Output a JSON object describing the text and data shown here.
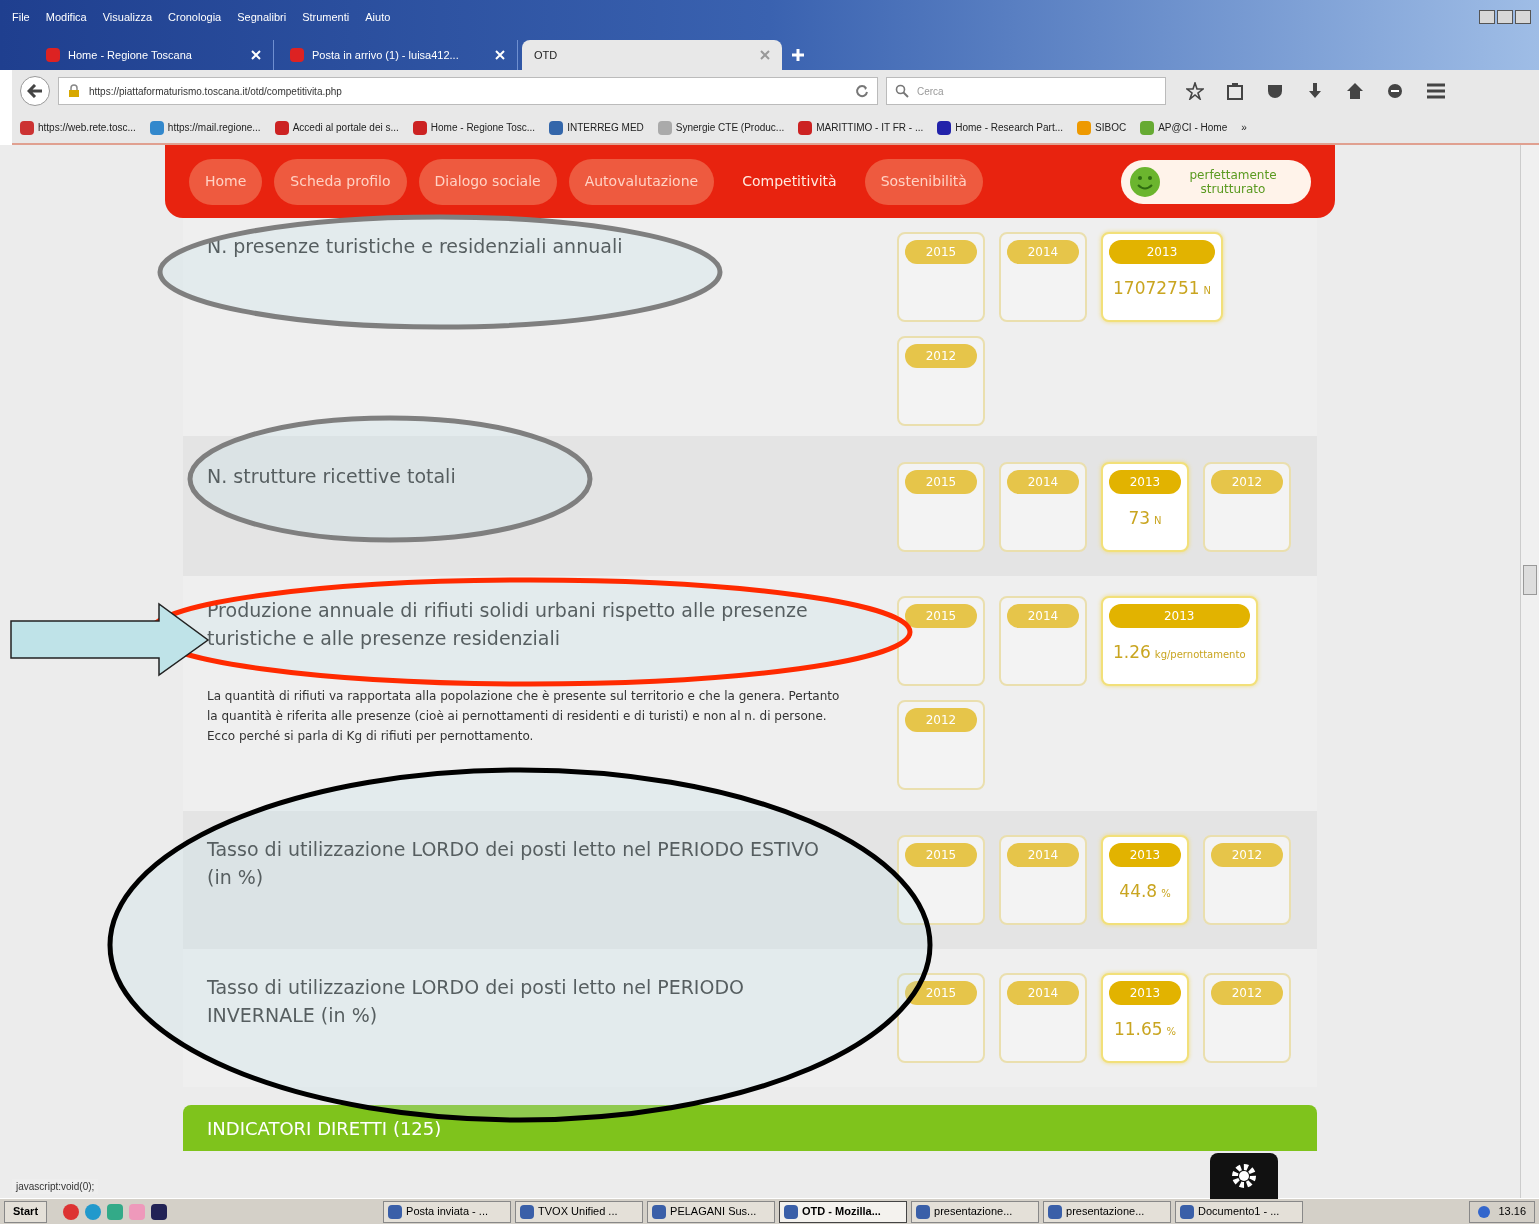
{
  "window": {
    "menu": [
      "File",
      "Modifica",
      "Visualizza",
      "Cronologia",
      "Segnalibri",
      "Strumenti",
      "Aiuto"
    ]
  },
  "tabs": [
    {
      "label": "Home - Regione Toscana",
      "selected": false
    },
    {
      "label": "Posta in arrivo (1) - luisa412...",
      "selected": false
    },
    {
      "label": "OTD",
      "selected": true
    }
  ],
  "address_bar": {
    "value": "https://piattaformaturismo.toscana.it/otd/competitivita.php"
  },
  "search": {
    "placeholder": "Cerca"
  },
  "bookmarks": [
    "https://web.rete.tosc...",
    "https://mail.regione...",
    "Accedi al portale dei s...",
    "Home - Regione Tosc...",
    "INTERREG MED",
    "Synergie CTE (Produc...",
    "MARITTIMO - IT FR - ...",
    "Home - Research Part...",
    "SIBOC",
    "AP@CI - Home",
    "»"
  ],
  "nav": [
    {
      "label": "Home",
      "selected": false
    },
    {
      "label": "Scheda profilo",
      "selected": false
    },
    {
      "label": "Dialogo sociale",
      "selected": false
    },
    {
      "label": "Autovalutazione",
      "selected": false
    },
    {
      "label": "Competitività",
      "selected": true
    },
    {
      "label": "Sostenibilità",
      "selected": false
    }
  ],
  "status_badge": {
    "text": "perfettamente strutturato"
  },
  "indicators": [
    {
      "title": "N. presenze turistiche e residenziali annuali",
      "years": [
        {
          "year": "2015",
          "selected": false
        },
        {
          "year": "2014",
          "selected": false
        },
        {
          "year": "2013",
          "selected": true,
          "value": "17072751",
          "unit": "N"
        },
        {
          "year": "2012",
          "selected": false
        }
      ]
    },
    {
      "title": "N. strutture ricettive totali",
      "years": [
        {
          "year": "2015",
          "selected": false
        },
        {
          "year": "2014",
          "selected": false
        },
        {
          "year": "2013",
          "selected": true,
          "value": "73",
          "unit": "N"
        },
        {
          "year": "2012",
          "selected": false
        }
      ]
    },
    {
      "title": "Produzione annuale di rifiuti solidi urbani rispetto alle presenze turistiche e alle presenze residenziali",
      "description": "La quantità di rifiuti va rapportata alla popolazione che è presente sul territorio e che la genera. Pertanto la quantità è riferita alle presenze (cioè ai pernottamenti di residenti e di turisti) e non al n. di persone. Ecco perché si parla di Kg di rifiuti per pernottamento.",
      "years": [
        {
          "year": "2015",
          "selected": false
        },
        {
          "year": "2014",
          "selected": false
        },
        {
          "year": "2013",
          "selected": true,
          "value": "1.26",
          "unit": "kg/pernottamento"
        },
        {
          "year": "2012",
          "selected": false
        }
      ]
    },
    {
      "title": "Tasso di utilizzazione LORDO dei posti letto nel PERIODO ESTIVO (in %)",
      "years": [
        {
          "year": "2015",
          "selected": false
        },
        {
          "year": "2014",
          "selected": false
        },
        {
          "year": "2013",
          "selected": true,
          "value": "44.8",
          "unit": "%"
        },
        {
          "year": "2012",
          "selected": false
        }
      ]
    },
    {
      "title": "Tasso di utilizzazione LORDO dei posti letto nel PERIODO INVERNALE (in %)",
      "years": [
        {
          "year": "2015",
          "selected": false
        },
        {
          "year": "2014",
          "selected": false
        },
        {
          "year": "2013",
          "selected": true,
          "value": "11.65",
          "unit": "%"
        },
        {
          "year": "2012",
          "selected": false
        }
      ]
    }
  ],
  "section_header": {
    "text": "INDICATORI DIRETTI (125)"
  },
  "annotations": [
    {
      "kind": "ellipse",
      "color": "#7f7f7f"
    },
    {
      "kind": "ellipse",
      "color": "#7f7f7f"
    },
    {
      "kind": "ellipse",
      "color": "#ff2a00"
    },
    {
      "kind": "ellipse",
      "color": "#000000"
    },
    {
      "kind": "arrow",
      "color": "#bfe3e8"
    }
  ],
  "status_bar": {
    "text": "javascript:void(0);"
  },
  "taskbar": {
    "start": "Start",
    "items": [
      {
        "label": "Posta inviata - ...",
        "selected": false
      },
      {
        "label": "TVOX Unified ...",
        "selected": false
      },
      {
        "label": "PELAGANI Sus...",
        "selected": false
      },
      {
        "label": "OTD - Mozilla...",
        "selected": true
      },
      {
        "label": "presentazione...",
        "selected": false
      },
      {
        "label": "presentazione...",
        "selected": false
      },
      {
        "label": "Documento1 - ...",
        "selected": false
      }
    ],
    "clock": "13.16"
  }
}
